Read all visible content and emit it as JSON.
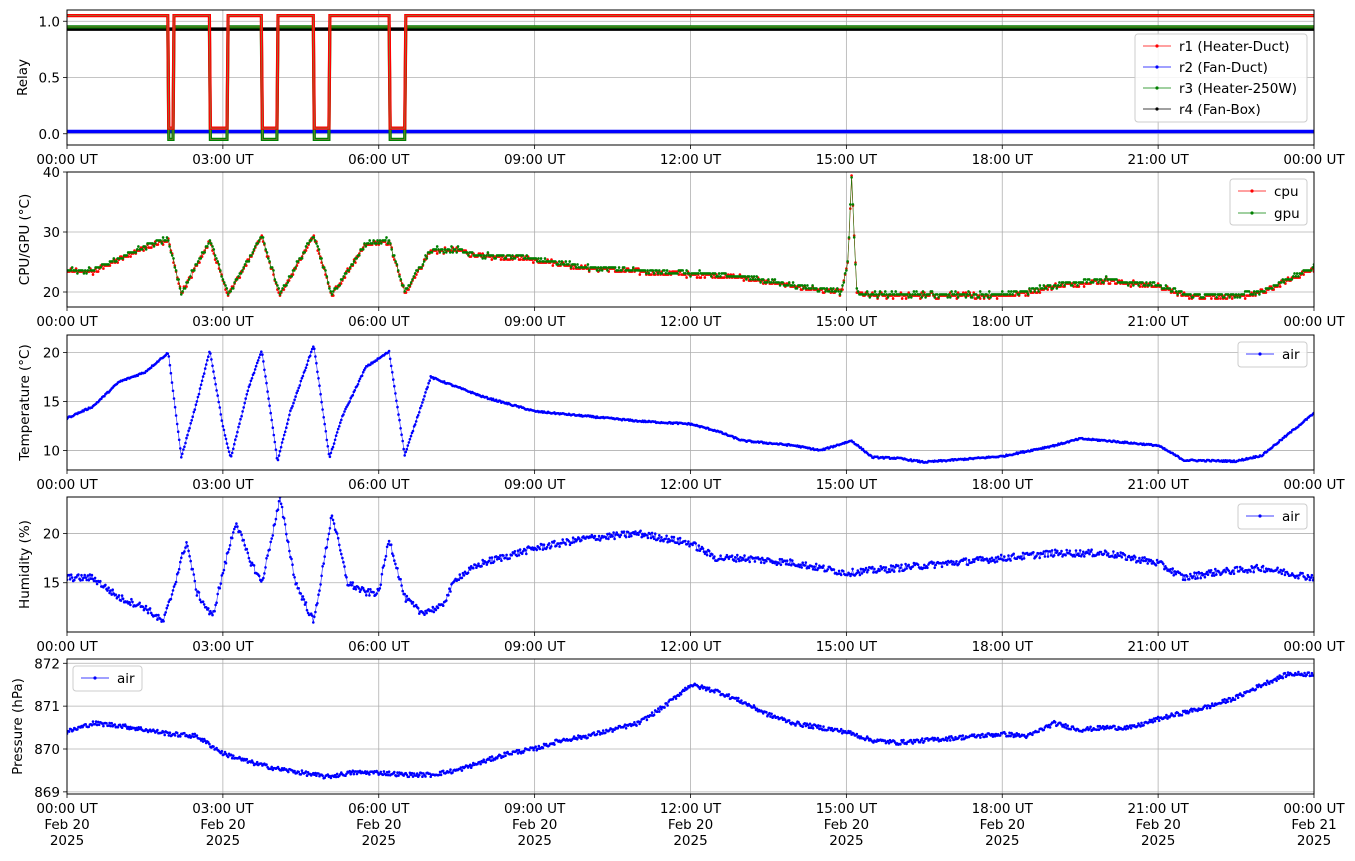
{
  "figure": {
    "background": "#ffffff"
  },
  "x_axis": {
    "range": [
      0,
      24
    ],
    "tick_labels": [
      "00:00 UT",
      "03:00 UT",
      "06:00 UT",
      "09:00 UT",
      "12:00 UT",
      "15:00 UT",
      "18:00 UT",
      "21:00 UT",
      "00:00 UT"
    ],
    "tick_dates": [
      "Feb 20",
      "Feb 20",
      "Feb 20",
      "Feb 20",
      "Feb 20",
      "Feb 20",
      "Feb 20",
      "Feb 20",
      "Feb 21"
    ],
    "tick_years": [
      "2025",
      "2025",
      "2025",
      "2025",
      "2025",
      "2025",
      "2025",
      "2025",
      "2025"
    ]
  },
  "chart_data": [
    {
      "type": "line",
      "ylabel": "Relay",
      "ylim": [
        -0.1,
        1.1
      ],
      "yticks": [
        "0.0",
        "0.5",
        "1.0"
      ],
      "grid": true,
      "legend": {
        "position": "right",
        "entries": [
          "r1 (Heater-Duct)",
          "r2 (Fan-Duct)",
          "r3 (Heater-250W)",
          "r4 (Fan-Box)"
        ]
      },
      "series": [
        {
          "name": "r1 (Heater-Duct)",
          "color": "#ff0000",
          "on_value": 1.05,
          "off_value": 0.05
        },
        {
          "name": "r2 (Fan-Duct)",
          "color": "#0000ff",
          "on_value": 0.02,
          "off_value": 0.02
        },
        {
          "name": "r3 (Heater-250W)",
          "color": "#008000",
          "on_value": 0.95,
          "off_value": -0.05
        },
        {
          "name": "r4 (Fan-Box)",
          "color": "#000000",
          "on_value": 0.93,
          "off_value": 0.93
        }
      ],
      "heater_off_intervals": [
        [
          1.95,
          2.05
        ],
        [
          2.75,
          3.1
        ],
        [
          3.75,
          4.05
        ],
        [
          4.75,
          5.05
        ],
        [
          6.2,
          6.5
        ]
      ]
    },
    {
      "type": "line",
      "ylabel": "CPU/GPU (°C)",
      "ylim": [
        17.5,
        40
      ],
      "yticks": [
        "20",
        "30",
        "40"
      ],
      "grid": true,
      "legend": {
        "position": "top-right",
        "entries": [
          "cpu",
          "gpu"
        ]
      },
      "series": [
        {
          "name": "cpu",
          "color": "#ff0000"
        },
        {
          "name": "gpu",
          "color": "#008000"
        }
      ],
      "x": [
        0,
        0.5,
        1.0,
        1.5,
        1.95,
        2.2,
        2.75,
        3.1,
        3.75,
        4.1,
        4.75,
        5.1,
        5.75,
        6.2,
        6.5,
        7.0,
        7.5,
        8.0,
        9.0,
        10.0,
        11.0,
        12.0,
        13.0,
        14.0,
        14.9,
        15.03,
        15.1,
        15.2,
        15.4,
        16.0,
        17.0,
        18.0,
        18.5,
        19.0,
        20.0,
        21.0,
        21.5,
        22.5,
        23.0,
        23.5,
        24.0
      ],
      "values": [
        23.5,
        23.5,
        25.5,
        27.5,
        28.8,
        19.8,
        28.5,
        19.5,
        29.3,
        19.5,
        29.5,
        19.5,
        28,
        28.5,
        19.8,
        27,
        27,
        26,
        25.5,
        24,
        23.5,
        23,
        22.5,
        21,
        20,
        25,
        39,
        20,
        19.5,
        19.5,
        19.5,
        19.5,
        20,
        21,
        22,
        21,
        19.5,
        19.3,
        20,
        22,
        24
      ]
    },
    {
      "type": "line",
      "ylabel": "Temperature (°C)",
      "ylim": [
        8,
        21.8
      ],
      "yticks": [
        "10",
        "15",
        "20"
      ],
      "grid": true,
      "legend": {
        "position": "top-right",
        "entries": [
          "air"
        ]
      },
      "series": [
        {
          "name": "air",
          "color": "#0000ff"
        }
      ],
      "x": [
        0,
        0.5,
        1.0,
        1.5,
        1.95,
        2.2,
        2.5,
        2.75,
        3.0,
        3.15,
        3.5,
        3.75,
        4.05,
        4.3,
        4.75,
        5.05,
        5.3,
        5.75,
        6.2,
        6.5,
        7.0,
        7.5,
        8.0,
        9.0,
        10.0,
        11.0,
        12.0,
        12.5,
        13.0,
        14.0,
        14.5,
        15.1,
        15.5,
        16.0,
        16.5,
        17.0,
        18.0,
        19.0,
        19.5,
        20.0,
        21.0,
        21.5,
        22.5,
        23.0,
        24.0
      ],
      "values": [
        13.3,
        14.5,
        17,
        18,
        20,
        9.3,
        15,
        20.2,
        12.5,
        9.2,
        16.5,
        20.2,
        8.9,
        14,
        20.8,
        9.2,
        13.5,
        18.5,
        20.1,
        9.5,
        17.5,
        16.5,
        15.5,
        14,
        13.5,
        13,
        12.7,
        12,
        11,
        10.5,
        10,
        11,
        9.3,
        9.2,
        8.8,
        9,
        9.4,
        10.5,
        11.2,
        11,
        10.5,
        9,
        8.9,
        9.5,
        13.8
      ]
    },
    {
      "type": "line",
      "ylabel": "Humidity (%)",
      "ylim": [
        10,
        23.7
      ],
      "yticks": [
        "15",
        "20"
      ],
      "grid": true,
      "legend": {
        "position": "top-right",
        "entries": [
          "air"
        ]
      },
      "series": [
        {
          "name": "air",
          "color": "#0000ff"
        }
      ],
      "x": [
        0,
        0.5,
        1.0,
        1.5,
        1.85,
        2.0,
        2.3,
        2.5,
        2.8,
        3.0,
        3.25,
        3.5,
        3.75,
        4.1,
        4.4,
        4.75,
        5.1,
        5.4,
        5.75,
        6.0,
        6.2,
        6.5,
        6.8,
        7.2,
        7.5,
        8.0,
        9.0,
        10.0,
        11.0,
        12.0,
        12.5,
        13.0,
        14.0,
        15.0,
        16.0,
        17.0,
        18.0,
        19.0,
        20.0,
        21.0,
        21.5,
        22.0,
        23.0,
        23.5,
        24.0
      ],
      "values": [
        15.5,
        15.5,
        13.5,
        12.5,
        11,
        13.5,
        19.2,
        14,
        11.5,
        16,
        21.2,
        17.5,
        15,
        23.5,
        15,
        11,
        22,
        15,
        14,
        14,
        19.5,
        13.5,
        12,
        12.5,
        15.5,
        17,
        18.5,
        19.5,
        20,
        19,
        17.5,
        17.5,
        17,
        16,
        16.5,
        17,
        17.5,
        18,
        18,
        17,
        15.5,
        16,
        16.5,
        16,
        15.5
      ]
    },
    {
      "type": "line",
      "ylabel": "Pressure (hPa)",
      "ylim": [
        868.95,
        872.1
      ],
      "yticks": [
        "869",
        "870",
        "871",
        "872"
      ],
      "grid": true,
      "legend": {
        "position": "top-left",
        "entries": [
          "air"
        ]
      },
      "series": [
        {
          "name": "air",
          "color": "#0000ff"
        }
      ],
      "x": [
        0,
        0.5,
        1.0,
        1.5,
        2.0,
        2.5,
        3.0,
        3.5,
        4.0,
        4.5,
        5.0,
        5.5,
        6.0,
        6.5,
        7.0,
        7.5,
        8.0,
        8.5,
        9.0,
        9.5,
        10.0,
        10.5,
        11.0,
        11.5,
        12.0,
        12.5,
        13.0,
        13.5,
        14.0,
        14.5,
        15.0,
        15.5,
        16.0,
        16.5,
        17.0,
        17.5,
        18.0,
        18.5,
        19.0,
        19.5,
        20.0,
        20.5,
        21.0,
        21.5,
        22.0,
        22.5,
        23.0,
        23.5,
        24.0
      ],
      "values": [
        870.4,
        870.6,
        870.55,
        870.45,
        870.35,
        870.3,
        869.9,
        869.7,
        869.55,
        869.45,
        869.35,
        869.45,
        869.45,
        869.4,
        869.4,
        869.5,
        869.7,
        869.9,
        870.0,
        870.2,
        870.3,
        870.45,
        870.6,
        871.0,
        871.5,
        871.35,
        871.1,
        870.8,
        870.6,
        870.5,
        870.4,
        870.2,
        870.15,
        870.2,
        870.25,
        870.3,
        870.35,
        870.3,
        870.6,
        870.45,
        870.5,
        870.5,
        870.7,
        870.85,
        871.0,
        871.2,
        871.5,
        871.75,
        871.75
      ]
    }
  ]
}
